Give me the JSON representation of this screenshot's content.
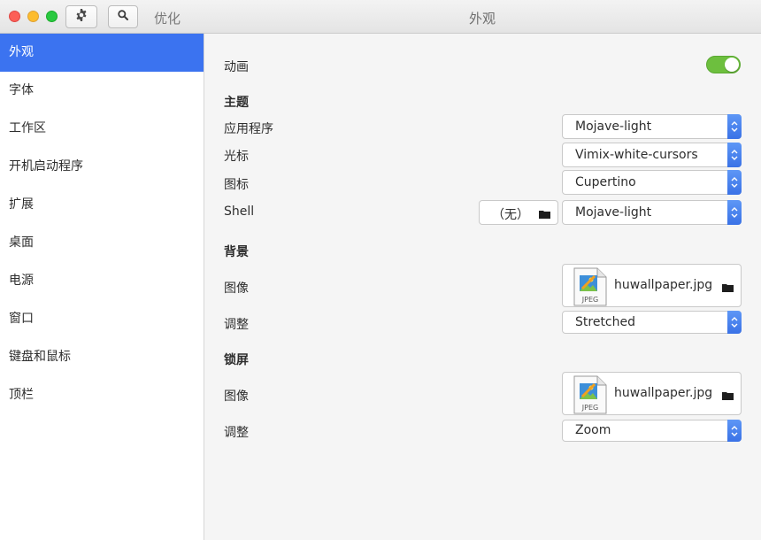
{
  "header": {
    "app_name": "优化",
    "window_title": "外观"
  },
  "sidebar": {
    "items": [
      {
        "label": "外观",
        "active": true
      },
      {
        "label": "字体"
      },
      {
        "label": "工作区"
      },
      {
        "label": "开机启动程序"
      },
      {
        "label": "扩展"
      },
      {
        "label": "桌面"
      },
      {
        "label": "电源"
      },
      {
        "label": "窗口"
      },
      {
        "label": "键盘和鼠标"
      },
      {
        "label": "顶栏"
      }
    ]
  },
  "appearance": {
    "animation_label": "动画",
    "animation_on": true,
    "themes_title": "主题",
    "applications_label": "应用程序",
    "applications_value": "Mojave-light",
    "cursor_label": "光标",
    "cursor_value": "Vimix-white-cursors",
    "icons_label": "图标",
    "icons_value": "Cupertino",
    "shell_label": "Shell",
    "shell_file_value": "（无）",
    "shell_value": "Mojave-light"
  },
  "background": {
    "title": "背景",
    "image_label": "图像",
    "image_file": "huwallpaper.jpg",
    "adjust_label": "调整",
    "adjust_value": "Stretched"
  },
  "lockscreen": {
    "title": "锁屏",
    "image_label": "图像",
    "image_file": "huwallpaper.jpg",
    "adjust_label": "调整",
    "adjust_value": "Zoom"
  },
  "file_icon_text": "JPEG",
  "colors": {
    "accent": "#3b73f0",
    "toggle_on": "#6dbf3e",
    "close": "#fc5f57",
    "minimize": "#fdbc2e",
    "maximize": "#29c940"
  }
}
